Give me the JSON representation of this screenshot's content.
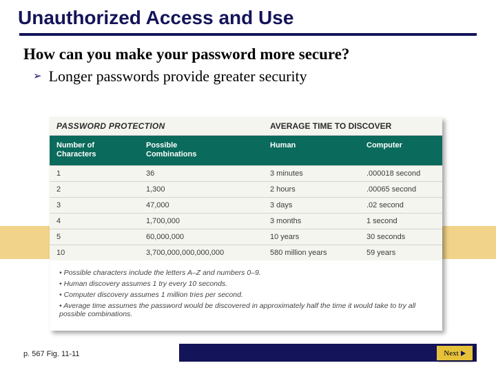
{
  "title": "Unauthorized Access and Use",
  "question": "How can you make your password more secure?",
  "bullet": "Longer passwords provide greater security",
  "figure": {
    "head_left": "PASSWORD PROTECTION",
    "head_right": "AVERAGE TIME TO DISCOVER",
    "sub": {
      "c1": "Number of\nCharacters",
      "c2": "Possible\nCombinations",
      "c3": "Human",
      "c4": "Computer"
    },
    "rows": [
      {
        "c1": "1",
        "c2": "36",
        "c3": "3 minutes",
        "c4": ".000018 second"
      },
      {
        "c1": "2",
        "c2": "1,300",
        "c3": "2 hours",
        "c4": ".00065 second"
      },
      {
        "c1": "3",
        "c2": "47,000",
        "c3": "3 days",
        "c4": ".02 second"
      },
      {
        "c1": "4",
        "c2": "1,700,000",
        "c3": "3 months",
        "c4": "1 second"
      },
      {
        "c1": "5",
        "c2": "60,000,000",
        "c3": "10 years",
        "c4": "30 seconds"
      },
      {
        "c1": "10",
        "c2": "3,700,000,000,000,000",
        "c3": "580 million years",
        "c4": "59 years"
      }
    ],
    "notes": [
      "Possible characters include the letters A–Z and numbers 0–9.",
      "Human discovery assumes 1 try every 10 seconds.",
      "Computer discovery assumes 1 million tries per second.",
      "Average time assumes the password would be discovered in approximately half the time it would take to try all possible combinations."
    ]
  },
  "page_ref": "p. 567 Fig. 11-11",
  "next_label": "Next"
}
